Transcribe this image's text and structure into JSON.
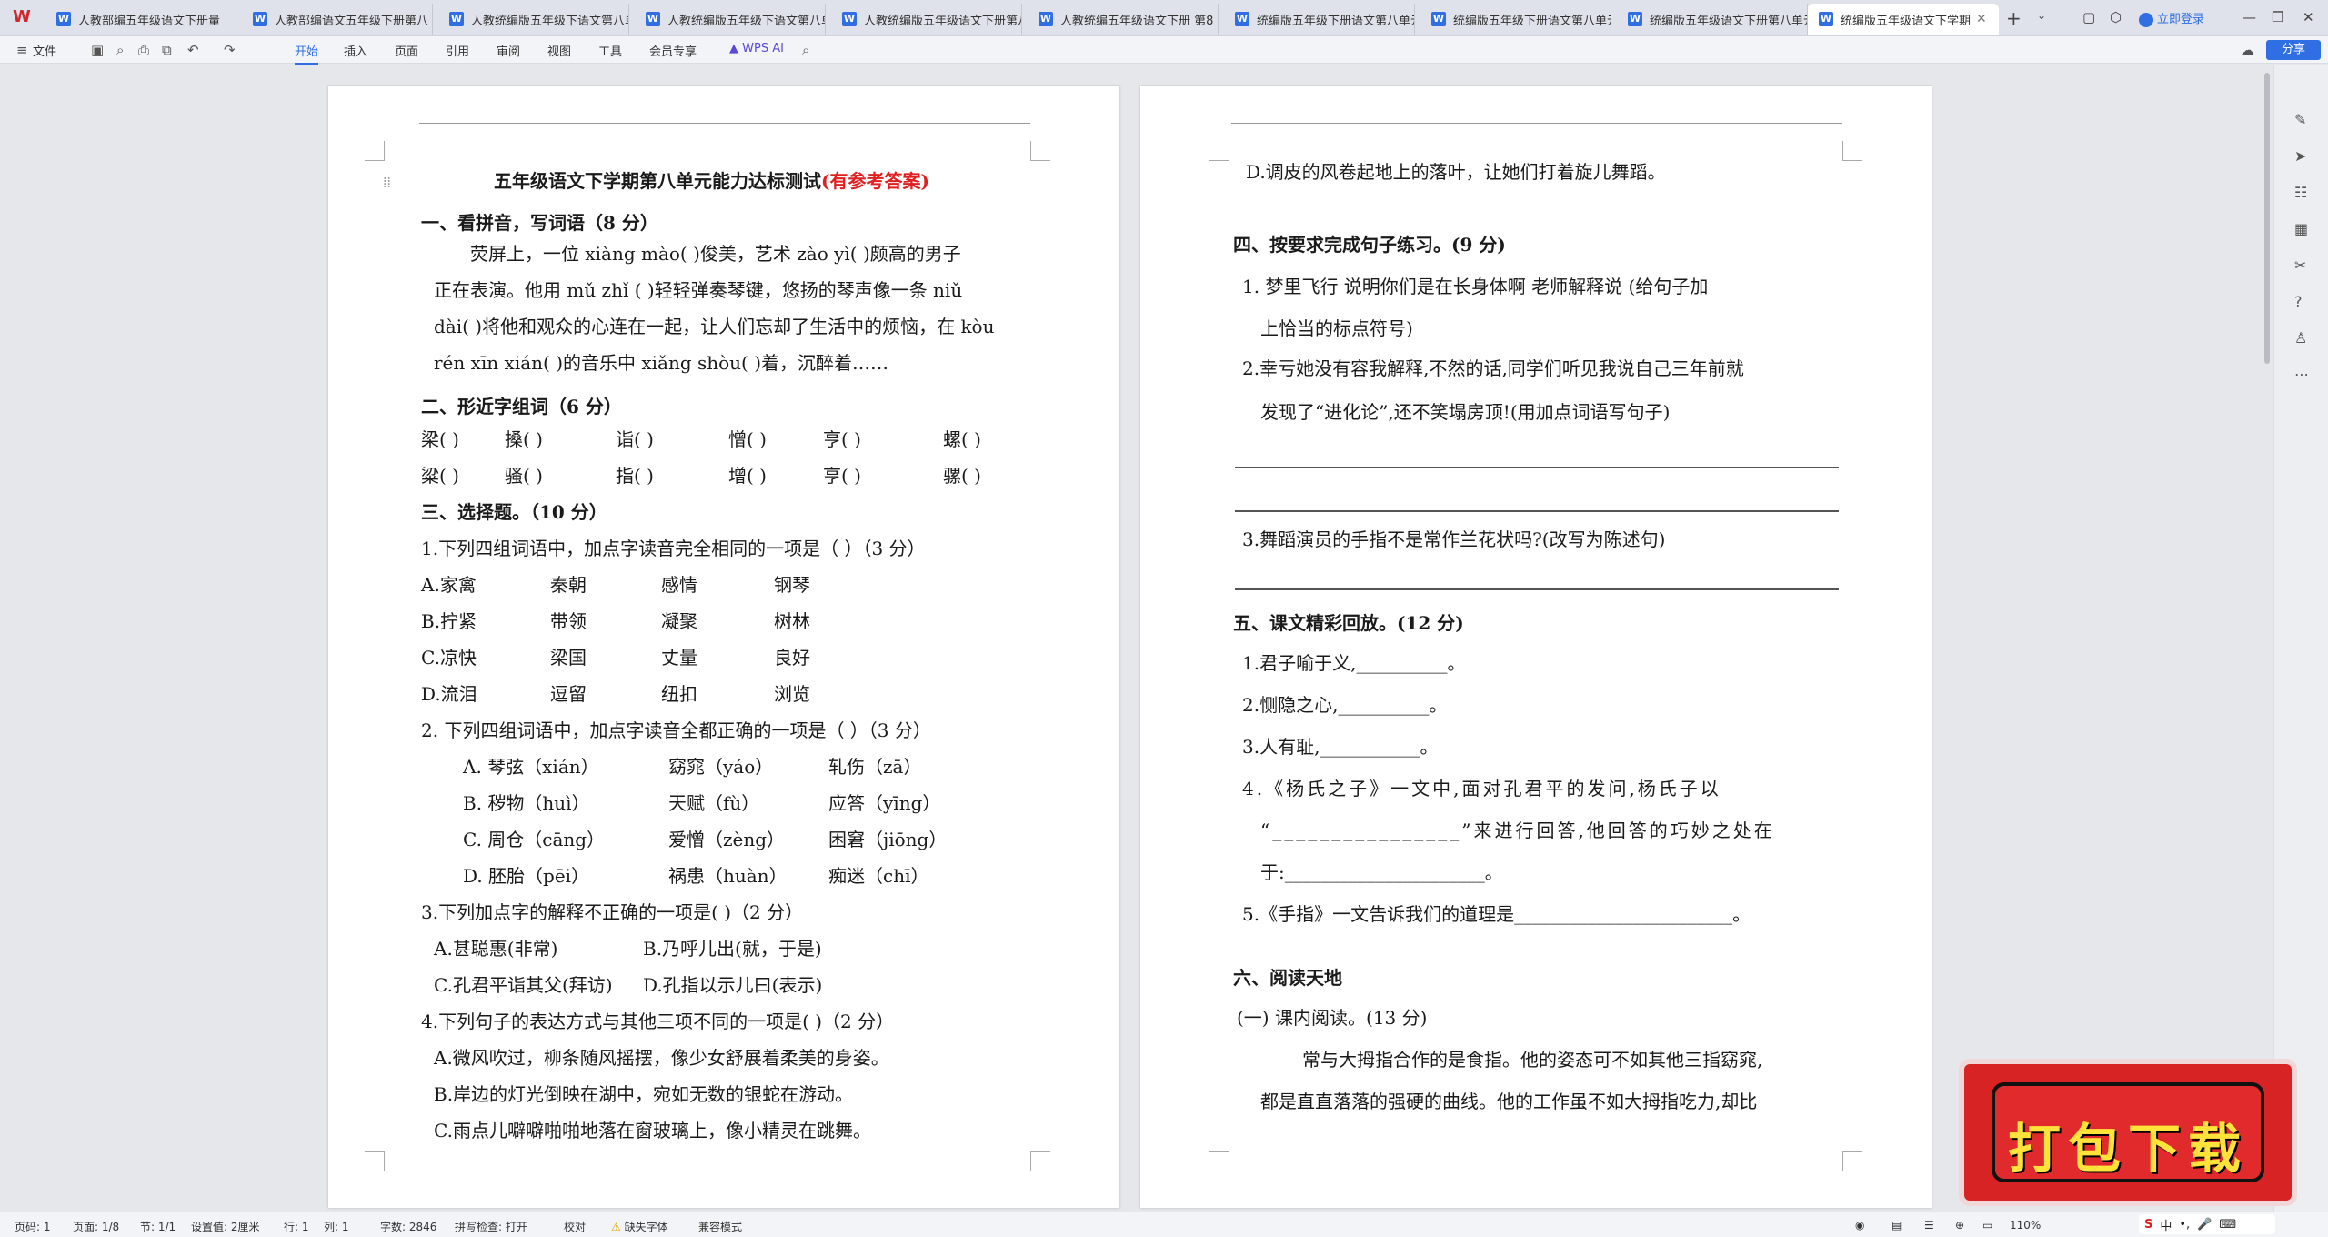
{
  "tabs": [
    {
      "label": "人教部编五年级语文下册量"
    },
    {
      "label": "人教部编语文五年级下册第八"
    },
    {
      "label": "人教统编版五年级下语文第八单"
    },
    {
      "label": "人教统编版五年级下语文第八单"
    },
    {
      "label": "人教统编版五年级语文下册第八单"
    },
    {
      "label": "人教统编五年级语文下册 第8"
    },
    {
      "label": "统编版五年级下册语文第八单元"
    },
    {
      "label": "统编版五年级下册语文第八单元"
    },
    {
      "label": "统编版五年级语文下册第八单元"
    },
    {
      "label": "统编版五年级语文下学期"
    }
  ],
  "window": {
    "login": "立即登录",
    "share": "分享"
  },
  "ribbon": {
    "file": "文件",
    "tabs": [
      "开始",
      "插入",
      "页面",
      "引用",
      "审阅",
      "视图",
      "工具",
      "会员专享"
    ],
    "ai": "WPS AI"
  },
  "page1": {
    "title": "五年级语文下学期第八单元能力达标测试",
    "title_red": "(有参考答案)",
    "s1": "一、看拼音，写词语（8 分）",
    "s1_l1": "荧屏上，一位 xiàng mào(          )俊美，艺术 zào yì(          )颇高的男子",
    "s1_l2": "正在表演。他用 mǔ zhǐ (          )轻轻弹奏琴键，悠扬的琴声像一条 niǔ",
    "s1_l3": "dài(          )将他和观众的心连在一起，让人们忘却了生活中的烦恼，在 kòu",
    "s1_l4": "rén xīn xián(            )的音乐中 xiǎng shòu(          )着，沉醉着……",
    "s2": "二、形近字组词（6 分）",
    "s2_r1": [
      "梁(    )",
      "搡(    )",
      "诣(    )",
      "憎(    )",
      "亨(    )",
      "螺(    )"
    ],
    "s2_r2": [
      "粱(    )",
      "骚(    )",
      "指(    )",
      "增(    )",
      "亨(    )",
      "骡(    )"
    ],
    "s3": "三、选择题。（10 分）",
    "q1": "1.下列四组词语中，加点字读音完全相同的一项是（        ）（3 分）",
    "q1_opts": [
      [
        "A.家禽",
        "秦朝",
        "感情",
        "钢琴"
      ],
      [
        "B.拧紧",
        "带领",
        "凝聚",
        "树林"
      ],
      [
        "C.凉快",
        "梁国",
        "丈量",
        "良好"
      ],
      [
        "D.流泪",
        "逗留",
        "纽扣",
        "浏览"
      ]
    ],
    "q2": "2. 下列四组词语中，加点字读音全都正确的一项是（        ）（3 分）",
    "q2_opts": [
      [
        "A. 琴弦（xián）",
        "窈窕（yáo）",
        "轧伤（zā）"
      ],
      [
        "B. 秽物（huì）",
        "天赋（fù）",
        "应答（yīng）"
      ],
      [
        "C. 周仓（cāng）",
        "爱憎（zèng）",
        "困窘（jiōng）"
      ],
      [
        "D. 胚胎（pēi）",
        "祸患（huàn）",
        "痴迷（chī）"
      ]
    ],
    "q3": "3.下列加点字的解释不正确的一项是(        )（2 分）",
    "q3_opts": [
      "A.甚聪惠(非常)",
      "B.乃呼儿出(就，于是)",
      "C.孔君平诣其父(拜访)",
      "D.孔指以示儿曰(表示)"
    ],
    "q4": "4.下列句子的表达方式与其他三项不同的一项是(        )（2 分）",
    "q4_opts": [
      "A.微风吹过，柳条随风摇摆，像少女舒展着柔美的身姿。",
      "B.岸边的灯光倒映在湖中，宛如无数的银蛇在游动。",
      "C.雨点儿噼噼啪啪地落在窗玻璃上，像小精灵在跳舞。"
    ]
  },
  "page2": {
    "d_opt": "D.调皮的风卷起地上的落叶，让她们打着旋儿舞蹈。",
    "s4": "四、按要求完成句子练习。(9 分)",
    "s4_q1a": "1.    梦里飞行    说明你们是在长身体啊    老师解释说    (给句子加",
    "s4_q1b": "上恰当的标点符号)",
    "s4_q2a": "2.幸亏她没有容我解释,不然的话,同学们听见我说自己三年前就",
    "s4_q2b": "发现了“进化论”,还不笑塌房顶!(用加点词语写句子)",
    "s4_q3": "3.舞蹈演员的手指不是常作兰花状吗?(改写为陈述句)",
    "s5": "五、课文精彩回放。(12 分)",
    "s5_q1": "1.君子喻于义,__________。",
    "s5_q2": "2.恻隐之心,__________。",
    "s5_q3": "3.人有耻,___________。",
    "s5_q4a": "4.《杨氏之子》一文中,面对孔君平的发问,杨氏子以",
    "s5_q4b": "“________________”来进行回答,他回答的巧妙之处在",
    "s5_q4c": "于:______________________。",
    "s5_q5": "5.《手指》一文告诉我们的道理是________________________。",
    "s6": "六、阅读天地",
    "s6_sub": "(一) 课内阅读。(13 分)",
    "s6_p1": "常与大拇指合作的是食指。他的姿态可不如其他三指窈窕,",
    "s6_p2": "都是直直落落的强硬的曲线。他的工作虽不如大拇指吃力,却比"
  },
  "promo": {
    "text": "打包下载"
  },
  "status": {
    "page": "页码: 1",
    "pages": "页面: 1/8",
    "section": "节: 1/1",
    "setting": "设置值: 2厘米",
    "row": "行: 1",
    "col": "列: 1",
    "words": "字数: 2846",
    "spell": "拼写检查: 打开",
    "proof": "校对",
    "font_missing": "缺失字体",
    "compat": "兼容模式",
    "zoom": "110%"
  },
  "ime": {
    "text": "中"
  }
}
